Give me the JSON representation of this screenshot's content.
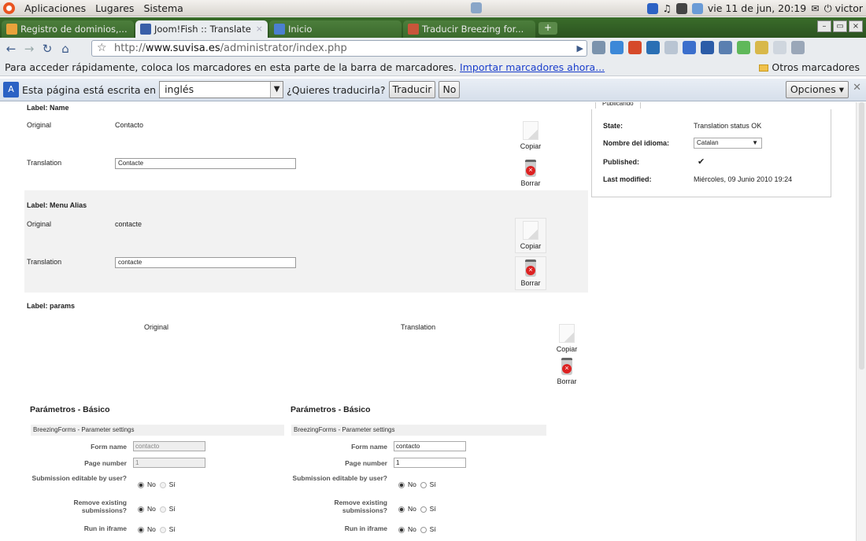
{
  "system_panel": {
    "menus": [
      "Aplicaciones",
      "Lugares",
      "Sistema"
    ],
    "clock": "vie 11 de jun, 20:19",
    "user": "victor"
  },
  "tabs": [
    {
      "title": "Registro de dominios,...",
      "active": false
    },
    {
      "title": "Joom!Fish :: Translate",
      "active": true
    },
    {
      "title": "Inicio",
      "active": false
    },
    {
      "title": "Traducir Breezing for...",
      "active": false
    }
  ],
  "toolbar": {
    "url_prefix": "http://",
    "url_domain": "www.suvisa.es",
    "url_path": "/administrator/index.php"
  },
  "bookmarks": {
    "prompt": "Para acceder rápidamente, coloca los marcadores en esta parte de la barra de marcadores.",
    "import_link": "Importar marcadores ahora...",
    "other": "Otros marcadores"
  },
  "translate_bar": {
    "prefix": "Esta página está escrita en",
    "language": "inglés",
    "question": "¿Quieres traducirla?",
    "translate_btn": "Traducir",
    "no_btn": "No",
    "options_btn": "Opciones"
  },
  "content": {
    "name_block": {
      "label": "Label: Name",
      "original_label": "Original",
      "original_value": "Contacto",
      "translation_label": "Translation",
      "translation_value": "Contacte"
    },
    "alias_block": {
      "label": "Label: Menu Alias",
      "original_label": "Original",
      "original_value": "contacte",
      "translation_label": "Translation",
      "translation_value": "contacte"
    },
    "params_block": {
      "label": "Label: params",
      "original_col": "Original",
      "translation_col": "Translation"
    },
    "copy_label": "Copiar",
    "delete_label": "Borrar",
    "params": {
      "section_title": "Parámetros - Básico",
      "settings_title": "BreezingForms - Parameter settings",
      "form_name_label": "Form name",
      "form_name_original": "contacto",
      "form_name_translation": "contacto",
      "page_number_label": "Page number",
      "page_number_original": "1",
      "page_number_translation": "1",
      "submission_editable_label": "Submission editable by user?",
      "remove_submissions_label": "Remove existing submissions?",
      "run_iframe_label": "Run in iframe",
      "no_label": "No",
      "si_label": "Sí"
    }
  },
  "publishing": {
    "tab_label": "Publicando",
    "state_key": "State:",
    "state_value": "Translation status OK",
    "lang_key": "Nombre del idioma:",
    "lang_value": "Catalan",
    "published_key": "Published:",
    "published_value": "✔",
    "modified_key": "Last modified:",
    "modified_value": "Miércoles, 09 Junio 2010 19:24"
  }
}
